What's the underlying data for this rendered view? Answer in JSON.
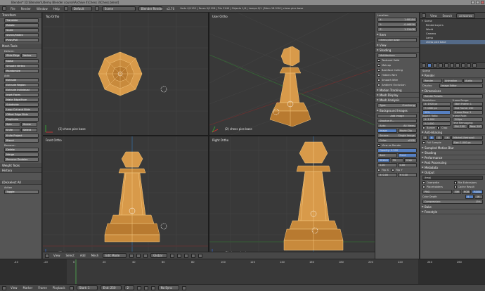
{
  "window": {
    "title": "Blender* [D:\\Blender\\Udemy Blender course\\Archive 4\\Chess 3\\Chess.blend]"
  },
  "info_header": {
    "menus": [
      "File",
      "Render",
      "Window",
      "Help"
    ],
    "screen_layout": "Default",
    "scene": "Scene",
    "render_engine": "Blender Render",
    "version": "v2.70",
    "stats": "Verts 0/1152 | Faces 0/1126 | Tris 2140 | Objects 1/4 | Lamps 0/1 | Mem 18.51M | chess pice base"
  },
  "tool_shelf": {
    "transform_header": "Transform",
    "transform_buttons": [
      "Translate",
      "Rotate",
      "Scale",
      "Shrink/Fatten",
      "Push/Pull"
    ],
    "mesh_tools_header": "Mesh Tools",
    "deform_label": "Deform:",
    "deform_row": [
      "Slide Edge",
      "Vertex"
    ],
    "deform_buttons": [
      "Noise",
      "Smooth Vertex",
      "Randomize"
    ],
    "add_label": "Add:",
    "extrude_dd": "Extrude",
    "add_buttons": [
      "Extrude Region",
      "Extrude Individual",
      "Inset Faces",
      "Make Edge/Face",
      "Subdivide",
      "Loop Cut and Slide",
      "Offset Edge Slide",
      "Duplicate"
    ],
    "spin_row": [
      "Spin",
      "Screw"
    ],
    "knife_row": [
      "Knife",
      "Select"
    ],
    "knife_project": "Knife Project",
    "bisect": "Bisect",
    "remove_label": "Remove:",
    "delete_dd": "Delete",
    "merge_dd": "Merge",
    "remove_doubles": "Remove Doubles",
    "weight_tools": "Weight Tools",
    "history": "History",
    "toggle_header": "(De)select All",
    "action_label": "Action",
    "action_dd": "Toggle"
  },
  "viewports": {
    "top_left": {
      "view": "Top Ortho",
      "object": "(2) chess pice base"
    },
    "top_right": {
      "view": "User Ortho",
      "object": "(2) chess pice base"
    },
    "bottom_left": {
      "view": "Front Ortho",
      "object": "(2) chess pice base"
    },
    "bottom_right": {
      "view": "Right Ortho",
      "object": "(2) chess pice base"
    }
  },
  "viewport_header": {
    "menus": [
      "View",
      "Select",
      "Add",
      "Mesh"
    ],
    "mode": "Edit Mode",
    "pivot": "Global"
  },
  "n_panel": {
    "location_header": "Location:",
    "location": [
      {
        "axis": "X:",
        "value": "1.68184"
      },
      {
        "axis": "Y:",
        "value": "-0.46856"
      },
      {
        "axis": "Z:",
        "value": "1.15408"
      }
    ],
    "item_header": "Item",
    "item_name": "chess pice base",
    "view_header": "View",
    "shading_header": "Shading",
    "shading_dd": "Multitexture",
    "shading_checks": [
      "Textured Solid",
      "Matcap",
      "Backface Culling",
      "Hidden Wire",
      "Smooth Wire",
      "Ambient Occlusion"
    ],
    "motion_tracking": "Motion Tracking",
    "mesh_display": "Mesh Display",
    "mesh_analysis": "Mesh Analysis",
    "type_label": "Type:",
    "type_dd": "Overhang",
    "background_images": "Background Images",
    "add_image": "Add Image",
    "stauton": "Stauton R...",
    "axis_label": "Axis:",
    "axis_dd": "All Views",
    "image_btn": "Image",
    "movie_clip_btn": "Movie Clip",
    "source_label": "Source:",
    "source_dd": "Single Image",
    "color_label": "Color:",
    "color_dd": "sRGB",
    "view_as_render": "View as Render",
    "opacity": "Opacity: 0.500",
    "back_btn": "Back",
    "front_btn": "Front",
    "stretch_btn": "Stretch",
    "fit_btn": "Fit",
    "crop_btn": "Crop",
    "size_field": "0.00",
    "size_field2": "0.00",
    "flip_x": "Flip X",
    "flip_y": "Flip Y",
    "x_field": "X: 0.00",
    "y_field": "Y: 0.00"
  },
  "outliner": {
    "menus": [
      "View",
      "Search"
    ],
    "dd": "All Scenes",
    "items": [
      "Scene",
      "RenderLayers",
      "World",
      "Camera",
      "Lamp",
      "chess pice base"
    ]
  },
  "properties": {
    "scene_name": "Scene",
    "render_header": "Render",
    "render_buttons": [
      "Render",
      "Animation",
      "Audio"
    ],
    "display_label": "Display:",
    "display_dd": "Image Editor",
    "dimensions_header": "Dimensions",
    "presets_dd": "Render Presets",
    "resolution_label": "Resolution:",
    "res_x": "X: 1920 px",
    "res_y": "Y: 1080 px",
    "res_pct": "50%",
    "frame_range_label": "Frame Range:",
    "start_frame": "Start Frame: 1",
    "end_frame": "End Frame: 250",
    "frame_step": "Frame Step: 1",
    "aspect_label": "Aspect Ratio:",
    "aspect_x": "X: 1.000",
    "aspect_y": "Y: 1.000",
    "frame_rate_label": "Frame Rate:",
    "fps": "24 fps",
    "time_remap_label": "Time Remapping:",
    "old": "Old: 100",
    "new": "New: 100",
    "border": "Border",
    "crop": "Crop",
    "anti_aliasing": "Anti-Aliasing",
    "aa_values": [
      "5",
      "8",
      "11",
      "16"
    ],
    "aa_filter": "Mitchell-Netravali",
    "full_sample": "Full Sample",
    "aa_size": "Size: 1.000 px",
    "sampled_motion_blur": "Sampled Motion Blur",
    "shading": "Shading",
    "performance": "Performance",
    "post_processing": "Post Processing",
    "metadata": "Metadata",
    "output": "Output",
    "output_path": "/tmp\\",
    "overwrite": "Overwrite",
    "file_extensions": "File Extensions",
    "placeholders": "Placeholders",
    "cache_result": "Cache Result",
    "png_label": "PNG",
    "bw": "BW",
    "rgb": "RGB",
    "rgba": "RGBA",
    "color_depth_label": "Color Depth:",
    "depth_8": "8",
    "depth_16": "16",
    "compression": "Compression:",
    "compression_pct": "15%",
    "bake": "Bake",
    "freestyle": "Freestyle"
  },
  "timeline": {
    "ticks": [
      "-40",
      "-20",
      "0",
      "20",
      "40",
      "60",
      "80",
      "100",
      "120",
      "140",
      "160",
      "180",
      "200",
      "220",
      "240",
      "260"
    ],
    "menus": [
      "View",
      "Marker",
      "Frame",
      "Playback"
    ],
    "start": "Start: 1",
    "end": "End: 250",
    "current": "2",
    "sync": "No Sync"
  }
}
